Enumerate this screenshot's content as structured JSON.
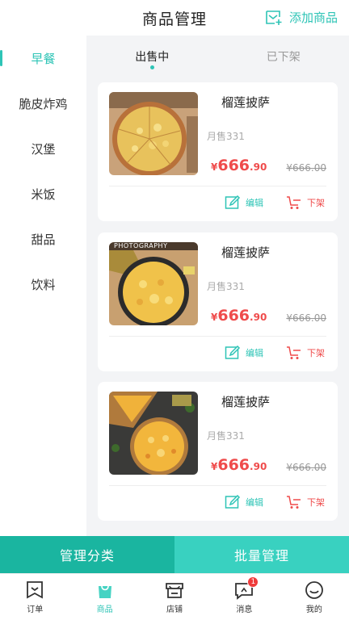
{
  "header": {
    "title": "商品管理",
    "add_label": "添加商品"
  },
  "sidebar": {
    "items": [
      {
        "label": "早餐",
        "active": true
      },
      {
        "label": "脆皮炸鸡"
      },
      {
        "label": "汉堡"
      },
      {
        "label": "米饭"
      },
      {
        "label": "甜品"
      },
      {
        "label": "饮料"
      }
    ]
  },
  "tabs": [
    {
      "label": "出售中",
      "active": true
    },
    {
      "label": "已下架"
    }
  ],
  "products": [
    {
      "name": "榴莲披萨",
      "sales": "月售331",
      "price_symbol": "¥",
      "price_int": "666",
      "price_dec": ".90",
      "original_price": "¥666.00",
      "edit_label": "编辑",
      "off_label": "下架"
    },
    {
      "name": "榴莲披萨",
      "sales": "月售331",
      "price_symbol": "¥",
      "price_int": "666",
      "price_dec": ".90",
      "original_price": "¥666.00",
      "edit_label": "编辑",
      "off_label": "下架",
      "image_text": "PHOTOGRAPHY"
    },
    {
      "name": "榴莲披萨",
      "sales": "月售331",
      "price_symbol": "¥",
      "price_int": "666",
      "price_dec": ".90",
      "original_price": "¥666.00",
      "edit_label": "编辑",
      "off_label": "下架"
    }
  ],
  "actions": {
    "manage_category": "管理分类",
    "batch_manage": "批量管理"
  },
  "tabbar": {
    "items": [
      {
        "label": "订单",
        "icon": "order-icon"
      },
      {
        "label": "商品",
        "icon": "bag-icon",
        "active": true
      },
      {
        "label": "店铺",
        "icon": "shop-icon"
      },
      {
        "label": "消息",
        "icon": "message-icon",
        "badge": "1"
      },
      {
        "label": "我的",
        "icon": "smile-icon"
      }
    ]
  },
  "colors": {
    "accent": "#2ec4b6",
    "price": "#ef4b4b",
    "dark_button": "#1ab5a0",
    "light_button": "#39d1c0"
  }
}
